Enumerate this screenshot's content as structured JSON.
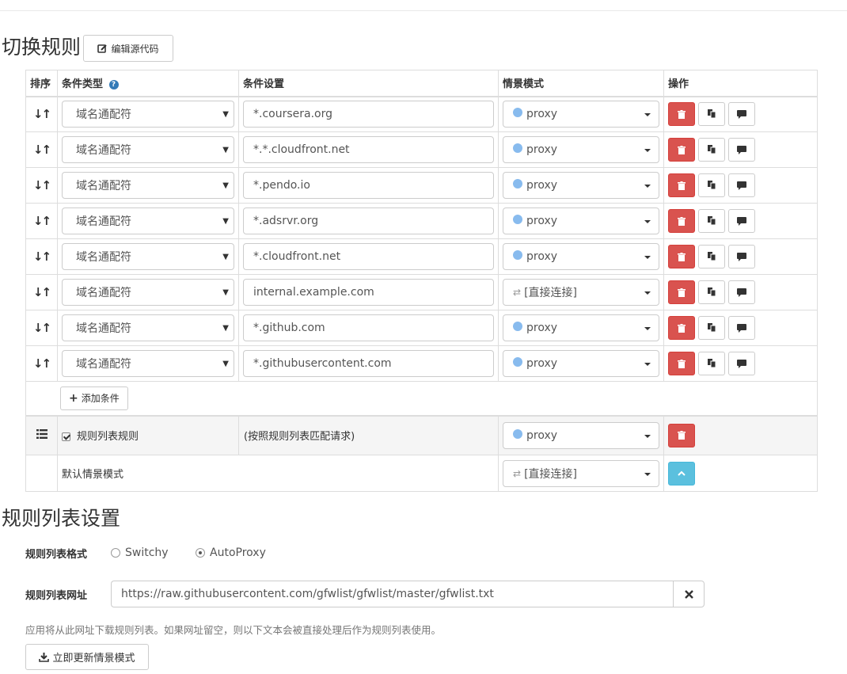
{
  "switch_section": {
    "title": "切换规则",
    "edit_source_label": "编辑源代码"
  },
  "table": {
    "headers": {
      "sort": "排序",
      "condition_type": "条件类型",
      "condition_setting": "条件设置",
      "profile": "情景模式",
      "actions": "操作"
    },
    "rows": [
      {
        "type": "域名通配符",
        "pattern": "*.coursera.org",
        "profile": "proxy",
        "profile_icon": "globe-icon"
      },
      {
        "type": "域名通配符",
        "pattern": "*.*.cloudfront.net",
        "profile": "proxy",
        "profile_icon": "globe-icon"
      },
      {
        "type": "域名通配符",
        "pattern": "*.pendo.io",
        "profile": "proxy",
        "profile_icon": "globe-icon"
      },
      {
        "type": "域名通配符",
        "pattern": "*.adsrvr.org",
        "profile": "proxy",
        "profile_icon": "globe-icon"
      },
      {
        "type": "域名通配符",
        "pattern": "*.cloudfront.net",
        "profile": "proxy",
        "profile_icon": "globe-icon"
      },
      {
        "type": "域名通配符",
        "pattern": "internal.example.com",
        "profile": "[直接连接]",
        "profile_icon": "direct-arrows-icon"
      },
      {
        "type": "域名通配符",
        "pattern": "*.github.com",
        "profile": "proxy",
        "profile_icon": "globe-icon"
      },
      {
        "type": "域名通配符",
        "pattern": "*.githubusercontent.com",
        "profile": "proxy",
        "profile_icon": "globe-icon"
      }
    ],
    "add_condition_label": "添加条件",
    "rule_list_row": {
      "label": "规则列表规则",
      "checked": true,
      "setting": "(按照规则列表匹配请求)",
      "profile": "proxy"
    },
    "default_row": {
      "label": "默认情景模式",
      "profile": "[直接连接]"
    }
  },
  "rulelist_section": {
    "title": "规则列表设置",
    "format_label": "规则列表格式",
    "format_options": [
      "Switchy",
      "AutoProxy"
    ],
    "format_selected": "AutoProxy",
    "url_label": "规则列表网址",
    "url_value": "https://raw.githubusercontent.com/gfwlist/gfwlist/master/gfwlist.txt",
    "hint": "应用将从此网址下载规则列表。如果网址留空，则以下文本会被直接处理后作为规则列表使用。",
    "update_label": "立即更新情景模式"
  },
  "colors": {
    "danger": "#d9534f",
    "info": "#5bc0de",
    "help_icon": "#337ab7"
  }
}
